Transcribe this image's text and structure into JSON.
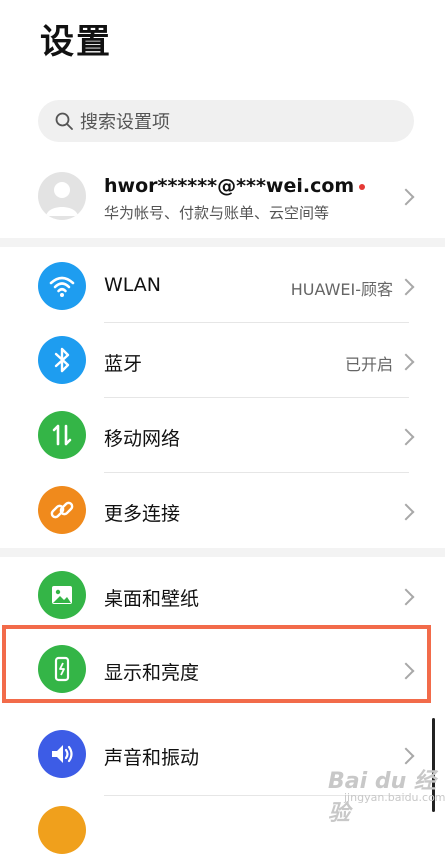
{
  "page": {
    "title": "设置"
  },
  "search": {
    "placeholder": "搜索设置项",
    "icon": "search-icon"
  },
  "account": {
    "name": "hwor******@***wei.com",
    "subtitle": "华为帐号、付款与账单、云空间等",
    "has_notification_dot": true,
    "icon": "avatar-icon"
  },
  "groups": [
    {
      "items": [
        {
          "id": "wlan",
          "label": "WLAN",
          "value": "HUAWEI-顾客",
          "icon": "wifi-icon",
          "color": "#1e9df0"
        },
        {
          "id": "bluetooth",
          "label": "蓝牙",
          "value": "已开启",
          "icon": "bluetooth-icon",
          "color": "#1e9df0"
        },
        {
          "id": "mobile-network",
          "label": "移动网络",
          "value": "",
          "icon": "mobile-data-icon",
          "color": "#34b547"
        },
        {
          "id": "more-connections",
          "label": "更多连接",
          "value": "",
          "icon": "link-icon",
          "color": "#f08a1c"
        }
      ]
    },
    {
      "items": [
        {
          "id": "wallpaper",
          "label": "桌面和壁纸",
          "value": "",
          "icon": "image-icon",
          "color": "#34b547"
        },
        {
          "id": "display",
          "label": "显示和亮度",
          "value": "",
          "icon": "display-brightness-icon",
          "color": "#34b547",
          "highlighted": true
        },
        {
          "id": "sound",
          "label": "声音和振动",
          "value": "",
          "icon": "speaker-icon",
          "color": "#3d5ce6"
        }
      ]
    }
  ],
  "watermark": {
    "text": "Bai du 经验",
    "sub": "jingyan.baidu.com"
  }
}
